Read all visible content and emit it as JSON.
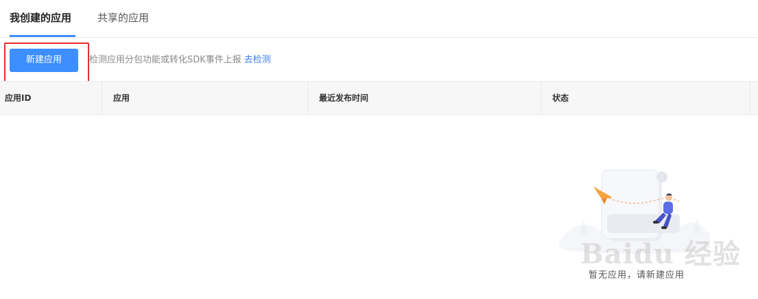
{
  "tabs": {
    "active_label": "我创建的应用",
    "inactive_label": "共享的应用"
  },
  "toolbar": {
    "create_button_label": "新建应用",
    "hint_text": "检测应用分包功能或转化SDK事件上报",
    "hint_link_label": "去检测"
  },
  "table": {
    "columns": [
      "应用ID",
      "应用",
      "最近发布时间",
      "状态"
    ]
  },
  "empty_state": {
    "message": "暂无应用，请新建应用"
  },
  "watermark": {
    "text": "Baidu 经验"
  },
  "colors": {
    "primary": "#3d8eff",
    "link": "#3d7fe6",
    "highlight": "#e52d2d"
  }
}
